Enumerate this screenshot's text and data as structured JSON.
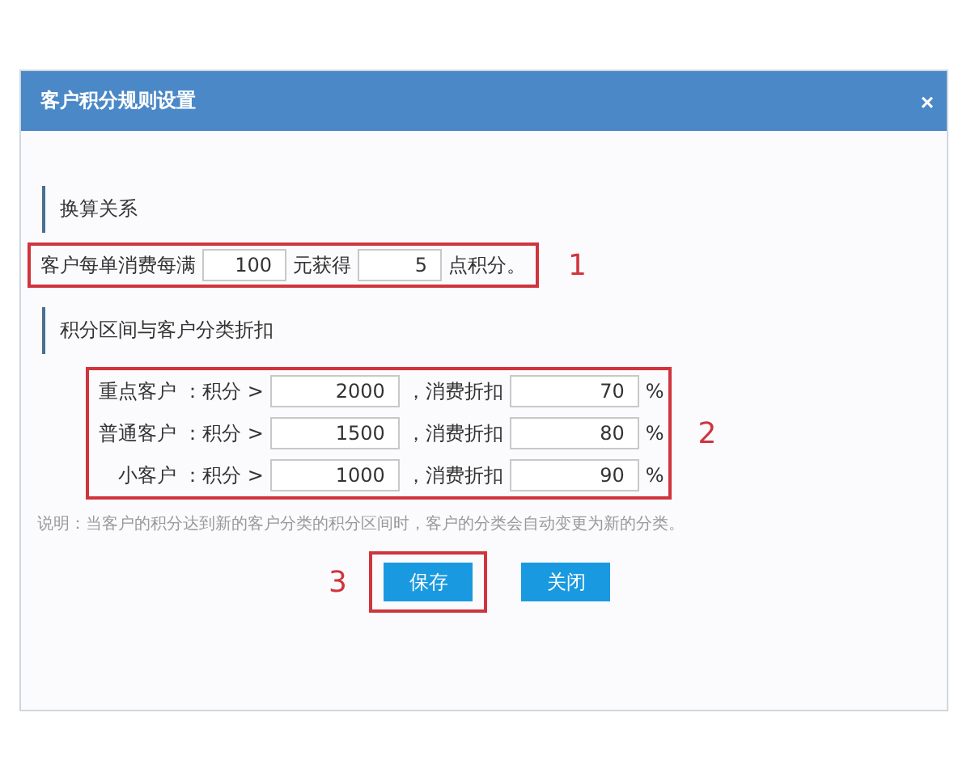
{
  "dialog": {
    "title": "客户积分规则设置",
    "close": "×"
  },
  "conversion": {
    "heading": "换算关系",
    "prefix": "客户每单消费每满",
    "amount": "100",
    "middle": "元获得",
    "points": "5",
    "suffix": "点积分。",
    "marker": "1"
  },
  "tiers": {
    "heading": "积分区间与客户分类折扣",
    "marker": "2",
    "rows": [
      {
        "name": "重点客户",
        "points_label": "：积分 >",
        "points": "2000",
        "discount_label": "，消费折扣",
        "discount": "70",
        "unit": "%"
      },
      {
        "name": "普通客户",
        "points_label": "：积分 >",
        "points": "1500",
        "discount_label": "，消费折扣",
        "discount": "80",
        "unit": "%"
      },
      {
        "name": "小客户",
        "points_label": "：积分 >",
        "points": "1000",
        "discount_label": "，消费折扣",
        "discount": "90",
        "unit": "%"
      }
    ]
  },
  "note": "说明：当客户的积分达到新的客户分类的积分区间时，客户的分类会自动变更为新的分类。",
  "buttons": [
    {
      "label": "保存",
      "marked": true,
      "marker": "3"
    },
    {
      "label": "关闭",
      "marked": false
    }
  ]
}
